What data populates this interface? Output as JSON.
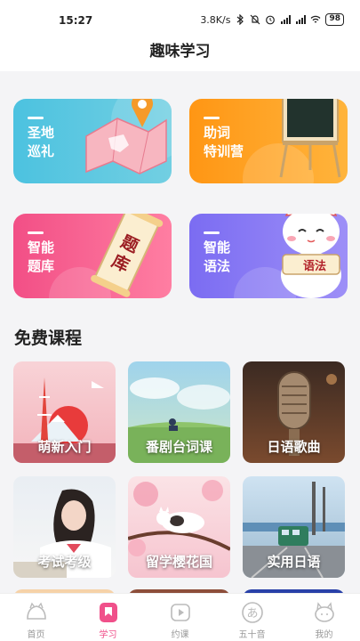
{
  "status_bar": {
    "time": "15:27",
    "speed": "3.8K/s",
    "battery": "98"
  },
  "header": {
    "title": "趣味学习"
  },
  "feature_cards": [
    {
      "label": "圣地\n巡礼",
      "color_from": "#4cc2e0",
      "color_to": "#6fd0e3",
      "icon": "map-pin-icon"
    },
    {
      "label": "助词\n特训营",
      "color_from": "#ff9a1a",
      "color_to": "#ffb13a",
      "icon": "chalkboard-icon"
    },
    {
      "label": "智能\n题库",
      "color_from": "#f2558a",
      "color_to": "#ff7aa0",
      "icon": "scroll-icon",
      "scroll_text": "题库"
    },
    {
      "label": "智能\n语法",
      "color_from": "#7d6ff3",
      "color_to": "#9a8cf7",
      "icon": "lucky-cat-icon",
      "scroll_text": "语法"
    }
  ],
  "free_courses": {
    "title": "免费课程",
    "items": [
      {
        "label": "萌新入门",
        "icon": "tokyo-tower-icon"
      },
      {
        "label": "番剧台词课",
        "icon": "anime-sky-icon"
      },
      {
        "label": "日语歌曲",
        "icon": "microphone-icon"
      },
      {
        "label": "考试考级",
        "icon": "student-icon"
      },
      {
        "label": "留学樱花国",
        "icon": "sakura-cat-icon"
      },
      {
        "label": "实用日语",
        "icon": "train-icon"
      }
    ]
  },
  "tabbar": {
    "items": [
      {
        "label": "首页",
        "icon": "home-icon",
        "active": false
      },
      {
        "label": "学习",
        "icon": "bookmark-icon",
        "active": true
      },
      {
        "label": "约课",
        "icon": "play-icon",
        "active": false
      },
      {
        "label": "五十音",
        "icon": "kana-icon",
        "active": false
      },
      {
        "label": "我的",
        "icon": "cat-face-icon",
        "active": false
      }
    ]
  },
  "colors": {
    "accent": "#f0508a",
    "background": "#f4f4f6"
  }
}
